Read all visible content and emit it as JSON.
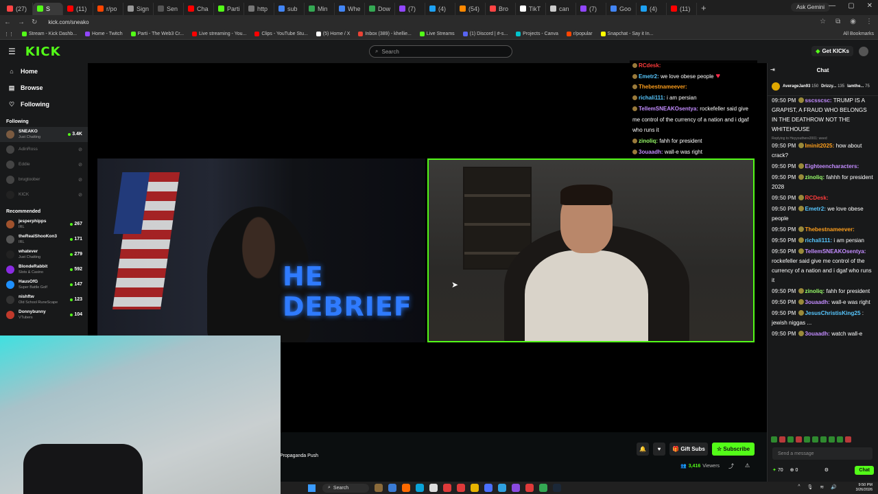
{
  "browser": {
    "tabs": [
      {
        "label": "(27)",
        "color": "#ff4444"
      },
      {
        "label": "S",
        "color": "#53fc18",
        "active": true
      },
      {
        "label": "(11)",
        "color": "#ff0000"
      },
      {
        "label": "r/po",
        "color": "#ff4500"
      },
      {
        "label": "Sign",
        "color": "#999999"
      },
      {
        "label": "Sen",
        "color": "#555555"
      },
      {
        "label": "Cha",
        "color": "#ff0000"
      },
      {
        "label": "Parti",
        "color": "#53fc18"
      },
      {
        "label": "http",
        "color": "#777777"
      },
      {
        "label": "sub",
        "color": "#4285f4"
      },
      {
        "label": "Min",
        "color": "#34a853"
      },
      {
        "label": "Whe",
        "color": "#4285f4"
      },
      {
        "label": "Dow",
        "color": "#34a853"
      },
      {
        "label": "(7)",
        "color": "#9146ff"
      },
      {
        "label": "(4)",
        "color": "#1da1f2"
      },
      {
        "label": "(54)",
        "color": "#ff8800"
      },
      {
        "label": "Bro",
        "color": "#ff4444"
      },
      {
        "label": "TikT",
        "color": "#ffffff"
      },
      {
        "label": "can",
        "color": "#cccccc"
      },
      {
        "label": "(7)",
        "color": "#9146ff"
      },
      {
        "label": "Goo",
        "color": "#4285f4"
      },
      {
        "label": "(4)",
        "color": "#1da1f2"
      },
      {
        "label": "(11)",
        "color": "#ff0000"
      }
    ],
    "new_tab": "+",
    "ask_gemini": "Ask Gemini",
    "url": "kick.com/sneako",
    "bookmarks": [
      {
        "label": "Stream - Kick Dashb...",
        "color": "#53fc18"
      },
      {
        "label": "Home - Twitch",
        "color": "#9146ff"
      },
      {
        "label": "Parti - The Web3 Cr...",
        "color": "#53fc18"
      },
      {
        "label": "Live streaming - You...",
        "color": "#ff0000"
      },
      {
        "label": "Clips - YouTube Stu...",
        "color": "#ff0000"
      },
      {
        "label": "(5) Home / X",
        "color": "#ffffff"
      },
      {
        "label": "Inbox (389) - khellie...",
        "color": "#ea4335"
      },
      {
        "label": "Live Streams",
        "color": "#53fc18"
      },
      {
        "label": "(1) Discord | #-s...",
        "color": "#5865f2"
      },
      {
        "label": "Projects - Canva",
        "color": "#00c4cc"
      },
      {
        "label": "r/popular",
        "color": "#ff4500"
      },
      {
        "label": "Snapchat - Say it In...",
        "color": "#fffc00"
      }
    ],
    "all_bookmarks": "All Bookmarks"
  },
  "header": {
    "logo": "KICK",
    "search_placeholder": "Search",
    "get_kicks": "Get KICKs"
  },
  "sidebar": {
    "nav": [
      {
        "label": "Home",
        "icon": "home-icon",
        "glyph": "⌂"
      },
      {
        "label": "Browse",
        "icon": "browse-icon",
        "glyph": "▤"
      },
      {
        "label": "Following",
        "icon": "heart-icon",
        "glyph": "♡"
      }
    ],
    "following_title": "Following",
    "following": [
      {
        "name": "SNEAKO",
        "category": "Just Chatting",
        "viewers": "3.4K",
        "live": true,
        "color": "#7a5a40"
      },
      {
        "name": "AdinRoss",
        "category": "",
        "viewers": "",
        "live": false,
        "color": "#444444"
      },
      {
        "name": "Eddie",
        "category": "",
        "viewers": "",
        "live": false,
        "color": "#444444"
      },
      {
        "name": "brugtoober",
        "category": "",
        "viewers": "",
        "live": false,
        "color": "#444444"
      },
      {
        "name": "KICK",
        "category": "",
        "viewers": "",
        "live": false,
        "color": "#222222"
      }
    ],
    "recommended_title": "Recommended",
    "recommended": [
      {
        "name": "jesperphipps",
        "category": "IRL",
        "viewers": "267",
        "color": "#a0522d"
      },
      {
        "name": "theRealShooKon3",
        "category": "IRL",
        "viewers": "171",
        "color": "#555555"
      },
      {
        "name": "whatever",
        "category": "Just Chatting",
        "viewers": "279",
        "color": "#222222"
      },
      {
        "name": "BlondeRabbit",
        "category": "Slots & Casino",
        "viewers": "592",
        "color": "#8a2be2"
      },
      {
        "name": "HausOfG",
        "category": "Super Battle Golf",
        "viewers": "147",
        "color": "#1e90ff"
      },
      {
        "name": "nishftw",
        "category": "Old School RuneScape",
        "viewers": "123",
        "color": "#333333"
      },
      {
        "name": "Donnybunny",
        "category": "VTubers",
        "viewers": "104",
        "color": "#c0392b"
      }
    ]
  },
  "stream": {
    "overlay_chat": [
      {
        "user": "RCdesk:",
        "text": "",
        "color": "#ff3b3b"
      },
      {
        "user": "Emetr2:",
        "text": "we love obese people",
        "color": "#57c7ff",
        "heart": true
      },
      {
        "user": "Thebestnameever:",
        "text": "",
        "color": "#ff9f1c"
      },
      {
        "user": "richali111:",
        "text": "i am persian",
        "color": "#57c7ff"
      },
      {
        "user": "TellemSNEAKOsentya:",
        "text": "rockefeller said give me control of the currency of a nation and i dgaf who runs it",
        "color": "#c38cff"
      },
      {
        "user": "zinoliq:",
        "text": "fahh for president",
        "color": "#9aff6b"
      },
      {
        "user": "3ouaadh:",
        "text": "wall-e was right",
        "color": "#c38cff"
      }
    ],
    "title": "Propaganda Push",
    "gift_subs": "Gift Subs",
    "subscribe": "Subscribe",
    "viewers": "3,416",
    "viewers_label": "Viewers",
    "debrief_text": "HE DEBRIEF"
  },
  "chat": {
    "title": "Chat",
    "pinned": [
      {
        "user": "AverageJan93",
        "amount": "150"
      },
      {
        "user": "Drizzy...",
        "amount": "135"
      },
      {
        "user": "lamthe...",
        "amount": "75"
      }
    ],
    "messages": [
      {
        "time": "09:50 PM",
        "user": "sscsscsc:",
        "text": "TRUMP IS A GRAPIST, A FRAUD WHO BELONGS IN THE DEATHROW NOT THE WHITEHOUSE",
        "color": "#c38cff"
      },
      {
        "reply": "Replying to Heyyouthere2001: weed"
      },
      {
        "time": "09:50 PM",
        "user": "Iminit2025:",
        "text": "how about crack?",
        "color": "#ff9f1c"
      },
      {
        "time": "09:50 PM",
        "user": "Eighteencharacters:",
        "text": "",
        "color": "#c38cff"
      },
      {
        "time": "09:50 PM",
        "user": "zinoliq:",
        "text": "fahhh for president 2028",
        "color": "#9aff6b"
      },
      {
        "time": "09:50 PM",
        "user": "RCDesk:",
        "text": "",
        "color": "#ff3b3b"
      },
      {
        "time": "09:50 PM",
        "user": "Emetr2:",
        "text": "we love obese people",
        "color": "#57c7ff"
      },
      {
        "time": "09:50 PM",
        "user": "Thebestnameever:",
        "text": "",
        "color": "#ff9f1c"
      },
      {
        "time": "09:50 PM",
        "user": "richali111:",
        "text": "i am persian",
        "color": "#57c7ff"
      },
      {
        "time": "09:50 PM",
        "user": "TellemSNEAKOsentya:",
        "text": "rockefeller said give me control of the currency of a nation and i dgaf who runs it",
        "color": "#c38cff"
      },
      {
        "time": "09:50 PM",
        "user": "zinoliq:",
        "text": "fahh for president",
        "color": "#9aff6b"
      },
      {
        "time": "09:50 PM",
        "user": "3ouaadh:",
        "text": "wall-e was right",
        "color": "#c38cff"
      },
      {
        "time": "09:50 PM",
        "user": "JesusChristisKing25",
        "text": ": jewish niggas ...",
        "color": "#57c7ff"
      },
      {
        "time": "09:50 PM",
        "user": "3ouaadh:",
        "text": "watch wall-e",
        "color": "#c38cff"
      }
    ],
    "send_placeholder": "Send a message",
    "kicks_count": "70",
    "points": "0",
    "chat_button": "Chat"
  },
  "taskbar": {
    "search": "Search",
    "time": "9:50 PM",
    "date": "3/26/2026"
  }
}
